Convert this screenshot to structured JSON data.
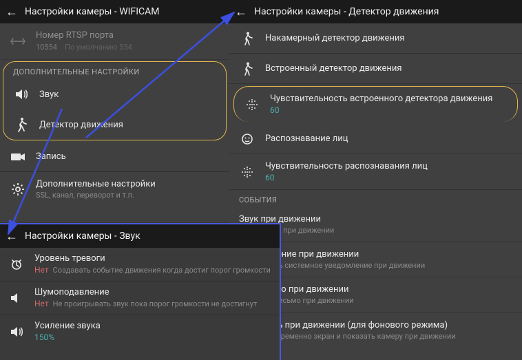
{
  "leftTop": {
    "title": "Настройки камеры - WIFICAM",
    "rtsp": {
      "label": "Номер RTSP порта",
      "value": "10554",
      "hint": "По умолчанию 554"
    },
    "section": "ДОПОЛНИТЕЛЬНЫЕ НАСТРОЙКИ",
    "items": {
      "sound": "Звук",
      "motion": "Детектор движения",
      "record": "Запись",
      "extra": "Дополнительные настройки",
      "extraSub": "SSL, канал, переворот и т.п."
    }
  },
  "right": {
    "title": "Настройки камеры - Детектор движения",
    "items": {
      "cam": "Накамерный детектор движения",
      "builtin": "Встроенный детектор движения",
      "sens": "Чувствительность встроенного детектора движения",
      "sensVal": "60",
      "face": "Распознавание лиц",
      "faceSens": "Чувствительность распознавания лиц",
      "faceVal": "60"
    },
    "events": {
      "section": "СОБЫТИЯ",
      "soundOn": "Звук при движении",
      "soundOnSub": "Играть звук при движении",
      "notify": "Уведомление при движении",
      "notifySub": "Показывать системное уведомление при движении",
      "email": "Эл. письмо при движении",
      "emailSub": "Отослать письмо при движении",
      "wake": "Разбудить при движении (для фонового режима)",
      "wakeSub": "Включить временно экран и показать камеру при движении"
    }
  },
  "leftBot": {
    "title": "Настройки камеры - Звук",
    "alarm": {
      "label": "Уровень тревоги",
      "off": "Нет",
      "sub": "Создавать событие движения когда достиг порог громкости"
    },
    "noise": {
      "label": "Шумоподавление",
      "off": "Нет",
      "sub": "Не проигрывать звук пока порог громкости не достигнут"
    },
    "gain": {
      "label": "Усиление звука",
      "val": "150%"
    }
  }
}
